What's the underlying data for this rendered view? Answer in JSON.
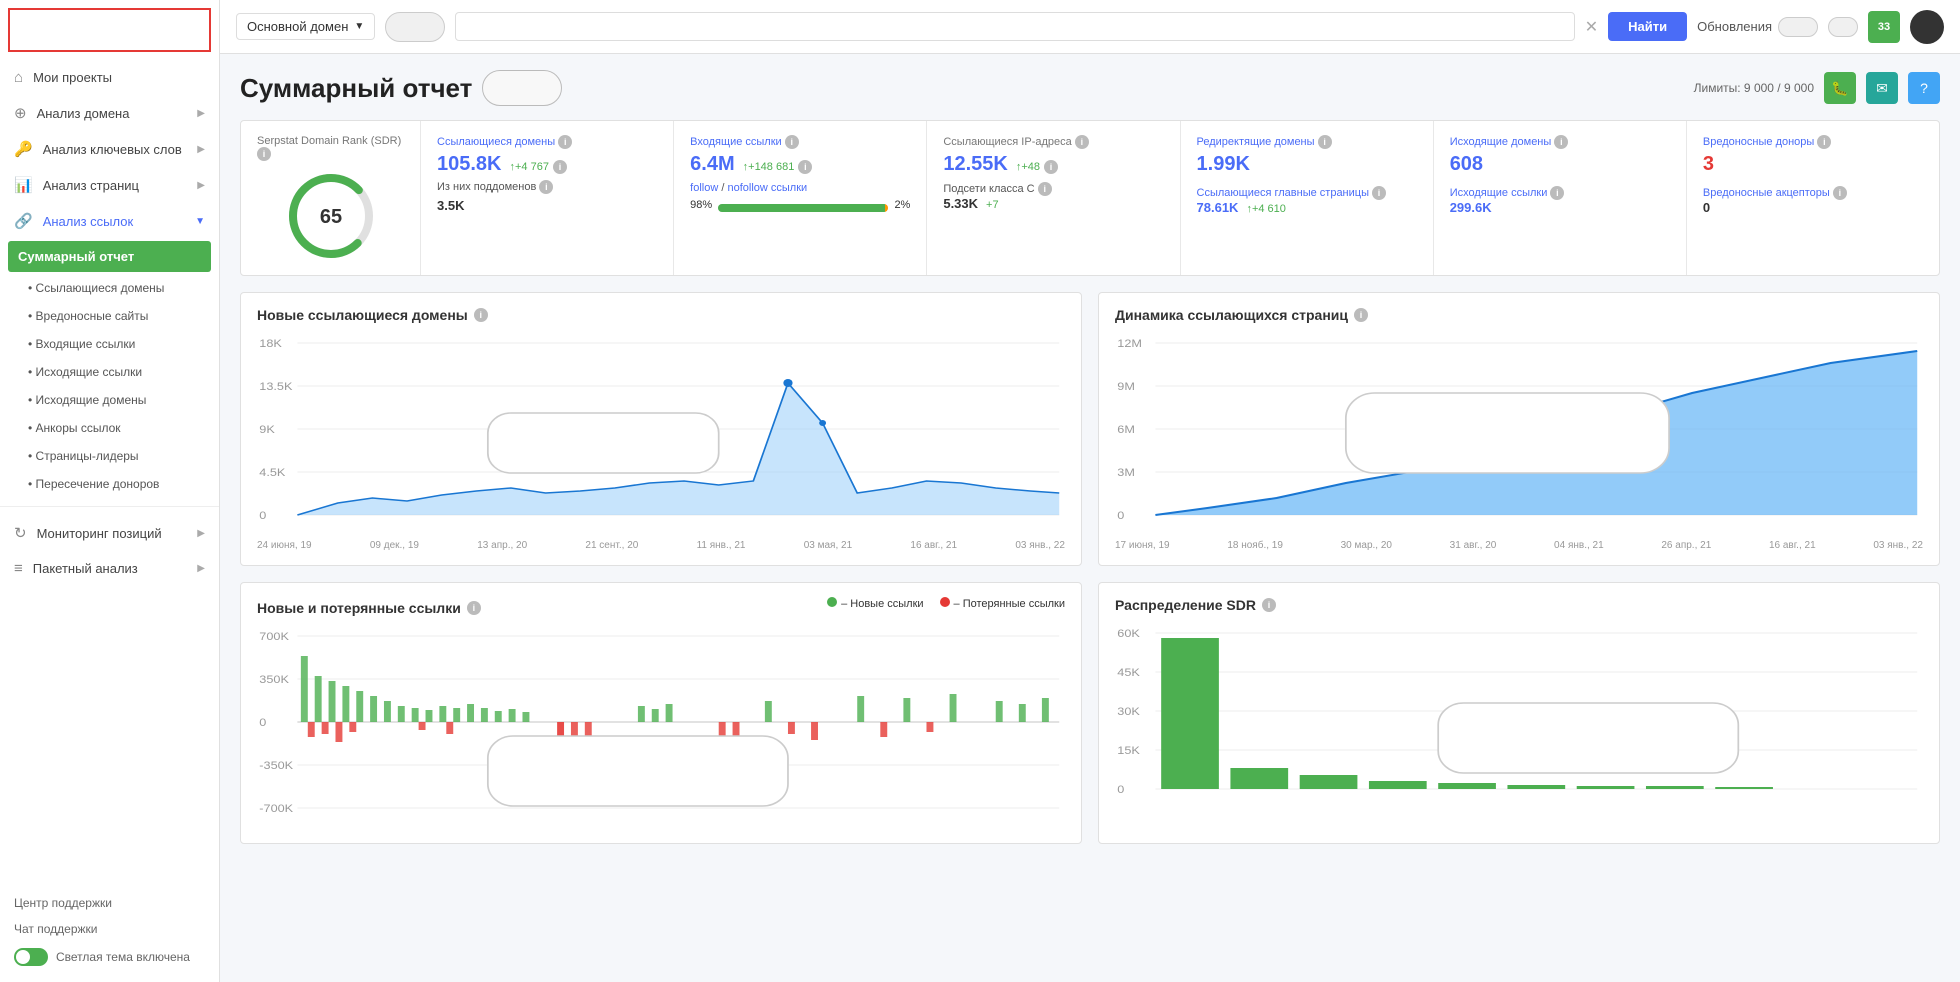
{
  "sidebar": {
    "my_projects": "Мои проекты",
    "domain_analysis": "Анализ домена",
    "keyword_analysis": "Анализ ключевых слов",
    "page_analysis": "Анализ страниц",
    "link_analysis": "Анализ ссылок",
    "summary_report": "Суммарный отчет",
    "referring_domains": "• Ссылающиеся домены",
    "malicious_sites": "• Вредоносные сайты",
    "incoming_links": "• Входящие ссылки",
    "outgoing_links": "• Исходящие ссылки",
    "outgoing_domains": "• Исходящие домены",
    "anchor_links": "• Анкоры ссылок",
    "leader_pages": "• Страницы-лидеры",
    "donor_intersect": "• Пересечение доноров",
    "position_monitoring": "Мониторинг позиций",
    "package_analysis": "Пакетный анализ",
    "support_center": "Центр поддержки",
    "support_chat": "Чат поддержки",
    "theme_toggle": "Светлая тема включена"
  },
  "topbar": {
    "domain_select": "Основной домен",
    "search_placeholder": "",
    "find_button": "Найти",
    "updates_label": "Обновления",
    "download_count": "33"
  },
  "report": {
    "title": "Суммарный отчет",
    "limits_label": "Лимиты: 9 000 / 9 000"
  },
  "stats": {
    "sdr_label": "Serpstat Domain Rank (SDR)",
    "sdr_value": "65",
    "referring_domains_label": "Ссылающиеся домены",
    "referring_domains_value": "105.8K",
    "referring_domains_delta": "+4 767",
    "subdomains_label": "Из них поддоменов",
    "subdomains_value": "3.5K",
    "incoming_links_label": "Входящие ссылки",
    "incoming_links_value": "6.4M",
    "incoming_links_delta": "+148 681",
    "follow_label": "follow",
    "nofollow_label": "nofollow ссылки",
    "follow_percent": "98%",
    "nofollow_percent": "2%",
    "referring_ips_label": "Ссылающиеся IP-адреса",
    "referring_ips_value": "12.55K",
    "referring_ips_delta": "+48",
    "subnets_label": "Подсети класса C",
    "subnets_value": "5.33K",
    "subnets_delta": "+7",
    "redirect_domains_label": "Редиректящие домены",
    "redirect_domains_value": "1.99K",
    "top_pages_label": "Ссылающиеся главные страницы",
    "top_pages_value": "78.61K",
    "top_pages_delta": "+4 610",
    "outgoing_domains_label": "Исходящие домены",
    "outgoing_domains_value": "608",
    "outgoing_links_label": "Исходящие ссылки",
    "outgoing_links_value": "299.6K",
    "malicious_donors_label": "Вредоносные доноры",
    "malicious_donors_value": "3",
    "malicious_acceptors_label": "Вредоносные акцепторы",
    "malicious_acceptors_value": "0"
  },
  "charts": {
    "new_domains_title": "Новые ссылающиеся домены",
    "new_domains_x": [
      "24 июня, 19",
      "09 дек., 19",
      "13 апр., 20",
      "21 сент., 20",
      "11 янв., 21",
      "03 мая, 21",
      "16 авг., 21",
      "03 янв., 22"
    ],
    "dynamics_title": "Динамика ссылающихся страниц",
    "dynamics_x": [
      "17 июня, 19",
      "18 нояб., 19",
      "30 мар., 20",
      "31 авг., 20",
      "04 янв., 21",
      "26 апр., 21",
      "16 авг., 21",
      "03 янв., 22"
    ],
    "new_lost_title": "Новые и потерянные ссылки",
    "new_links_legend": "– Новые ссылки",
    "lost_links_legend": "– Потерянные ссылки",
    "sdr_distribution_title": "Распределение SDR",
    "new_lost_y": [
      "700K",
      "350K",
      "0",
      "-350K",
      "-700K"
    ],
    "new_domains_y": [
      "18K",
      "13.5K",
      "9K",
      "4.5K",
      "0"
    ],
    "dynamics_y": [
      "12M",
      "9M",
      "6M",
      "3M",
      "0"
    ],
    "sdr_y": [
      "60K",
      "45K",
      "30K",
      "15K",
      "0"
    ]
  }
}
